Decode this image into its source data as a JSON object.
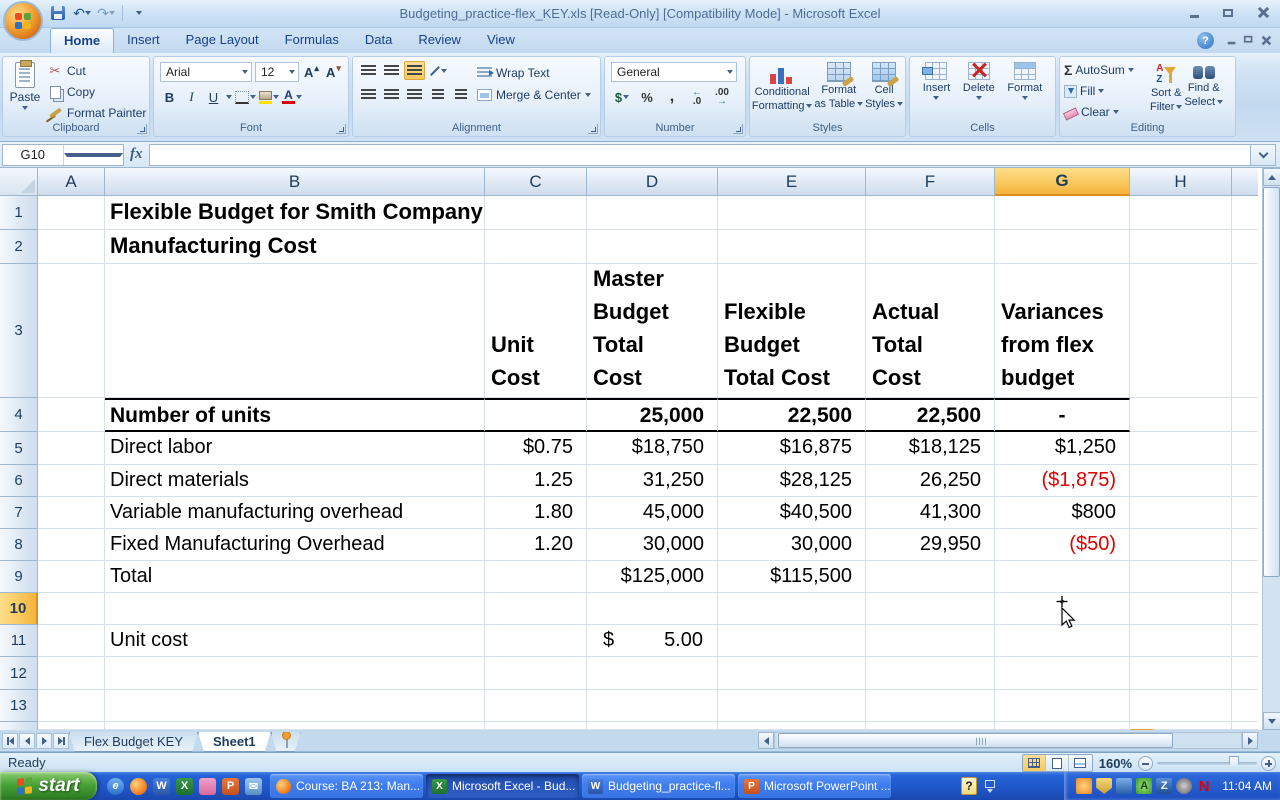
{
  "window": {
    "title": "Budgeting_practice-flex_KEY.xls  [Read-Only]  [Compatibility Mode] - Microsoft Excel"
  },
  "icons": {
    "fx": "fx",
    "help": "?",
    "undo": "↶",
    "redo": "↷",
    "scissors": "✂",
    "bold": "B",
    "italic": "I",
    "underline": "U",
    "dollar": "$",
    "percent": "%",
    "comma": ",",
    "dec_inc": ".0",
    "dec_dec": ".00",
    "sum": "Σ",
    "sortA": "A",
    "sortZ": "Z"
  },
  "ribbon_tabs": [
    {
      "label": "Home"
    },
    {
      "label": "Insert"
    },
    {
      "label": "Page Layout"
    },
    {
      "label": "Formulas"
    },
    {
      "label": "Data"
    },
    {
      "label": "Review"
    },
    {
      "label": "View"
    }
  ],
  "ribbon": {
    "clipboard": {
      "group_label": "Clipboard",
      "paste": "Paste",
      "cut": "Cut",
      "copy": "Copy",
      "format_painter": "Format Painter"
    },
    "font": {
      "group_label": "Font",
      "font_name": "Arial",
      "font_size": "12"
    },
    "alignment": {
      "group_label": "Alignment",
      "wrap_text": "Wrap Text",
      "merge_center": "Merge & Center"
    },
    "number": {
      "group_label": "Number",
      "format": "General"
    },
    "styles": {
      "group_label": "Styles",
      "conditional_1": "Conditional",
      "conditional_2": "Formatting",
      "format_table_1": "Format",
      "format_table_2": "as Table",
      "cell_styles_1": "Cell",
      "cell_styles_2": "Styles"
    },
    "cells": {
      "group_label": "Cells",
      "insert": "Insert",
      "delete": "Delete",
      "format": "Format"
    },
    "editing": {
      "group_label": "Editing",
      "autosum": "AutoSum",
      "fill": "Fill",
      "clear": "Clear",
      "sort_1": "Sort &",
      "sort_2": "Filter",
      "find_1": "Find &",
      "find_2": "Select"
    }
  },
  "formula_bar": {
    "name_box": "G10",
    "content": ""
  },
  "sheet": {
    "columns": [
      "A",
      "B",
      "C",
      "D",
      "E",
      "F",
      "G",
      "H"
    ],
    "row_numbers": [
      "1",
      "2",
      "3",
      "4",
      "5",
      "6",
      "7",
      "8",
      "9",
      "10",
      "11",
      "12",
      "13"
    ],
    "selection": {
      "cell": "G10"
    },
    "cells": {
      "B1": "Flexible Budget for Smith Company",
      "B2": "Manufacturing Cost",
      "C3": "Unit Cost",
      "D3": "Master Budget Total Cost",
      "E3": "Flexible Budget Total Cost",
      "F3": "Actual Total Cost",
      "G3": "Variances from flex budget",
      "B4": "Number of units",
      "D4": "25,000",
      "E4": "22,500",
      "F4": "22,500",
      "G4": "-",
      "B5": "Direct labor",
      "C5": "$0.75",
      "D5": "$18,750",
      "E5": "$16,875",
      "F5": "$18,125",
      "G5": "$1,250",
      "B6": "Direct materials",
      "C6": "1.25",
      "D6": "31,250",
      "E6": "$28,125",
      "F6": "26,250",
      "G6": "($1,875)",
      "B7": "Variable manufacturing overhead",
      "C7": "1.80",
      "D7": "45,000",
      "E7": "$40,500",
      "F7": "41,300",
      "G7": "$800",
      "B8": "Fixed Manufacturing Overhead",
      "C8": "1.20",
      "D8": "30,000",
      "E8": "30,000",
      "F8": "29,950",
      "G8": "($50)",
      "B9": "Total",
      "D9": "$125,000",
      "E9": "$115,500",
      "B11": "Unit cost",
      "D11_symbol": "$",
      "D11_value": "5.00"
    }
  },
  "sheet_tabs": {
    "tab_1": "Flex Budget KEY",
    "tab_2": "Sheet1"
  },
  "status_bar": {
    "mode": "Ready",
    "zoom_level": "160%"
  },
  "taskbar": {
    "start_label": "start",
    "quick_launch": [
      {
        "name": "internet-explorer",
        "glyph": "e"
      },
      {
        "name": "firefox",
        "glyph": ""
      },
      {
        "name": "word",
        "glyph": "W"
      },
      {
        "name": "excel",
        "glyph": "X"
      },
      {
        "name": "keys",
        "glyph": ""
      },
      {
        "name": "powerpoint",
        "glyph": "P"
      },
      {
        "name": "outlook",
        "glyph": "✉"
      }
    ],
    "buttons": [
      {
        "label": "Course: BA 213: Man...",
        "icon": "firefox"
      },
      {
        "label": "Microsoft Excel - Bud...",
        "icon": "excel"
      },
      {
        "label": "Budgeting_practice-fl...",
        "icon": "word"
      },
      {
        "label": "Microsoft PowerPoint ...",
        "icon": "powerpoint"
      }
    ],
    "tray": [
      {
        "name": "messenger",
        "glyph": ""
      },
      {
        "name": "shield",
        "glyph": ""
      },
      {
        "name": "tools",
        "glyph": ""
      },
      {
        "name": "antivirus",
        "glyph": "A"
      },
      {
        "name": "zip",
        "glyph": "Z"
      },
      {
        "name": "volume",
        "glyph": ""
      },
      {
        "name": "novell",
        "glyph": "N"
      }
    ],
    "clock": "11:04 AM"
  }
}
